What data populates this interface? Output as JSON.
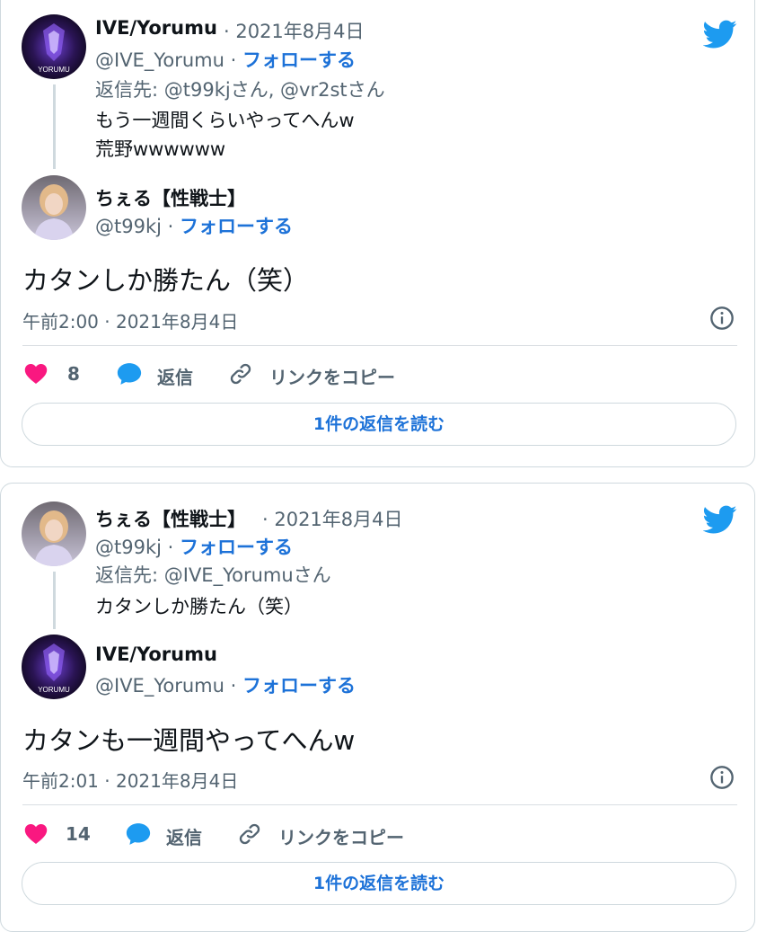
{
  "tweets": [
    {
      "parent": {
        "name": "IVE/Yorumu",
        "date": "· 2021年8月4日",
        "handle": "@IVE_Yorumu",
        "follow_label": "フォローする",
        "reply_to": "返信先: @t99kjさん, @vr2stさん",
        "text_line1": "もう一週間くらいやってへんw",
        "text_line2": "荒野wwwwww",
        "avatar_text": "YORUMU"
      },
      "main": {
        "name": "ちぇる【性戦士】",
        "handle": "@t99kj",
        "follow_label": "フォローする",
        "text": "カタンしか勝たん（笑）",
        "timestamp": "午前2:00 · 2021年8月4日"
      },
      "actions": {
        "likes": "8",
        "reply_label": "返信",
        "copy_label": "リンクをコピー"
      },
      "read_replies_label": "1件の返信を読む"
    },
    {
      "parent": {
        "name": "ちぇる【性戦士】",
        "date": "· 2021年8月4日",
        "handle": "@t99kj",
        "follow_label": "フォローする",
        "reply_to": "返信先: @IVE_Yorumuさん",
        "text_line1": "カタンしか勝たん（笑）"
      },
      "main": {
        "name": "IVE/Yorumu",
        "handle": "@IVE_Yorumu",
        "follow_label": "フォローする",
        "text": "カタンも一週間やってへんw",
        "timestamp": "午前2:01 · 2021年8月4日",
        "avatar_text": "YORUMU"
      },
      "actions": {
        "likes": "14",
        "reply_label": "返信",
        "copy_label": "リンクをコピー"
      },
      "read_replies_label": "1件の返信を読む"
    }
  ],
  "colors": {
    "accent": "#1d9bf0",
    "like": "#f91880",
    "follow": "#1d72d8",
    "muted": "#536471"
  },
  "icons": [
    "twitter-bird-icon",
    "info-icon",
    "heart-icon",
    "reply-bubble-icon",
    "link-icon"
  ]
}
